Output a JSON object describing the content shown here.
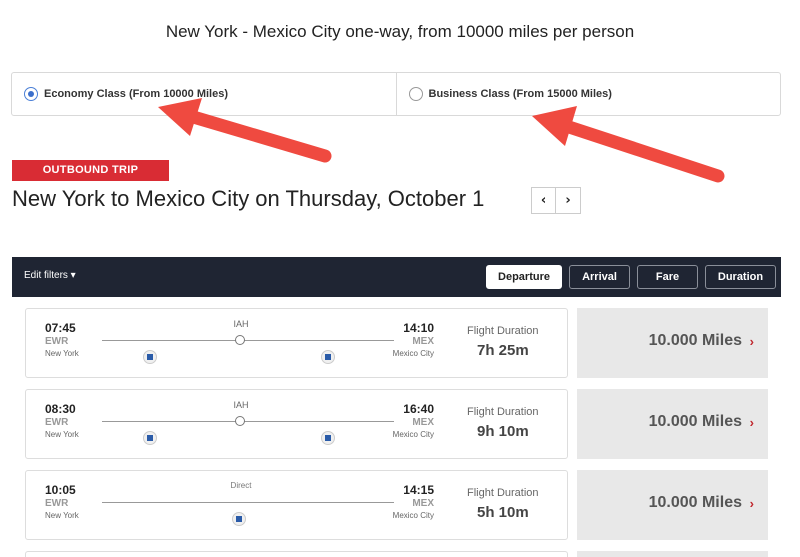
{
  "headline": "New York - Mexico City one-way, from 10000 miles per person",
  "classes": {
    "economy": "Economy Class (From 10000 Miles)",
    "business": "Business Class (From 15000 Miles)"
  },
  "trip": {
    "badge": "OUTBOUND TRIP",
    "title": "New York to Mexico City on Thursday, October 1",
    "prev": "‹",
    "next": "›"
  },
  "filters": {
    "edit": "Edit filters ▾",
    "sort": [
      "Departure",
      "Arrival",
      "Fare",
      "Duration"
    ],
    "active_sort": "Departure"
  },
  "flights": [
    {
      "dep_time": "07:45",
      "dep_airport": "EWR",
      "dep_city": "New York",
      "arr_time": "14:10",
      "arr_airport": "MEX",
      "arr_city": "Mexico City",
      "stop": "IAH",
      "duration_label": "Flight Duration",
      "duration": "7h 25m",
      "fare": "10.000 Miles",
      "chevron": "›"
    },
    {
      "dep_time": "08:30",
      "dep_airport": "EWR",
      "dep_city": "New York",
      "arr_time": "16:40",
      "arr_airport": "MEX",
      "arr_city": "Mexico City",
      "stop": "IAH",
      "duration_label": "Flight Duration",
      "duration": "9h 10m",
      "fare": "10.000 Miles",
      "chevron": "›"
    },
    {
      "dep_time": "10:05",
      "dep_airport": "EWR",
      "dep_city": "New York",
      "arr_time": "14:15",
      "arr_airport": "MEX",
      "arr_city": "Mexico City",
      "stop": "Direct",
      "duration_label": "Flight Duration",
      "duration": "5h 10m",
      "fare": "10.000 Miles",
      "chevron": "›"
    }
  ],
  "colors": {
    "accent_red": "#d92c34",
    "header_dark": "#1f2533",
    "radio_blue": "#3b6fcc",
    "arrow_red": "#ef4a40"
  }
}
